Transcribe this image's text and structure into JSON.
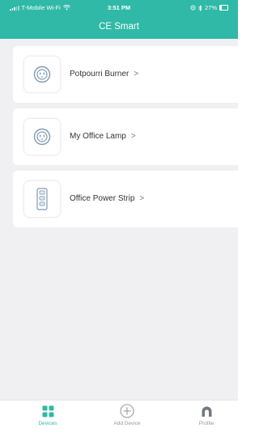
{
  "status_bar": {
    "carrier": "T-Mobile Wi-Fi",
    "time": "3:51 PM",
    "battery": "27%"
  },
  "header": {
    "title": "CE Smart"
  },
  "devices": [
    {
      "name": "Potpourri Burner",
      "icon": "smart-plug-icon"
    },
    {
      "name": "My Office Lamp",
      "icon": "smart-plug-icon"
    },
    {
      "name": "Office Power Strip",
      "icon": "power-strip-icon"
    }
  ],
  "tab_bar": {
    "tabs": [
      {
        "label": "Devices",
        "icon": "grid-icon",
        "active": true
      },
      {
        "label": "Add Device",
        "icon": "plus-circle-icon",
        "active": false
      },
      {
        "label": "Profile",
        "icon": "profile-icon",
        "active": false
      }
    ]
  },
  "colors": {
    "accent": "#2fb9a6",
    "background": "#f0f0f3",
    "card": "#ffffff",
    "inactive_tab": "#9a9a9a"
  },
  "chevron_glyph": ">"
}
